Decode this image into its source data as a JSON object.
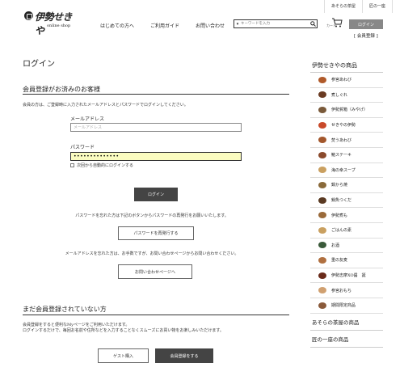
{
  "top_links": [
    "あそらの茶屋",
    "匠の一座"
  ],
  "logo": {
    "main": "伊勢せきや",
    "sub": "online shop"
  },
  "nav": [
    "はじめての方へ",
    "ご利用ガイド",
    "お問い合わせ"
  ],
  "search": {
    "dropdown": "▾",
    "placeholder": "キーワードを入力"
  },
  "cart": {
    "label": "カート"
  },
  "header": {
    "login": "ログイン",
    "register": "[ 会員登録 ]"
  },
  "main": {
    "title": "ログイン",
    "member": {
      "heading": "会員登録がお済みのお客様",
      "desc": "会員の方は、ご登録時に入力されたメールアドレスとパスワードでログインしてください。",
      "email_label": "メールアドレス",
      "email_placeholder": "メールアドレス",
      "password_label": "パスワード",
      "password_value": "••••••••••••••",
      "remember": "次回から自動的にログインする",
      "login_button": "ログイン",
      "forgot_text": "パスワードを忘れた方は下記のボタンからパスワードの再発行をお願いいたします。",
      "reissue_button": "パスワードを再発行する",
      "email_forgot_text": "メールアドレスを忘れた方は、お手数ですが、お問い合わせページからお問い合わせください。",
      "contact_button": "お問い合わせページへ"
    },
    "guest": {
      "heading": "まだ会員登録されていない方",
      "desc1": "会員登録をすると便利なMyページをご利用いただけます。",
      "desc2": "ログインするだけで、毎回お名前や住所などを入力することなくスムーズにお買い物をお楽しみいただけます。",
      "guest_button": "ゲスト購入",
      "register_button": "会員登録をする"
    }
  },
  "sidebar": {
    "heading": "伊勢せきやの商品",
    "items": [
      {
        "label": "参宮あわび",
        "color": "#b05a2a"
      },
      {
        "label": "煮しぐれ",
        "color": "#6a3b22"
      },
      {
        "label": "伊勢賀箱（みやげ）",
        "color": "#7a5a3a"
      },
      {
        "label": "せきやの伊勢",
        "color": "#c94a2a"
      },
      {
        "label": "焚うあわび",
        "color": "#a3572c"
      },
      {
        "label": "鮑ステーキ",
        "color": "#8b4a2c"
      },
      {
        "label": "海の幸スープ",
        "color": "#caa060"
      },
      {
        "label": "鍋から焼",
        "color": "#8a6a3a"
      },
      {
        "label": "鍋魚つくだ",
        "color": "#5a3a22"
      },
      {
        "label": "伊勢煮も",
        "color": "#9a6a3a"
      },
      {
        "label": "ごはんの素",
        "color": "#c9a060"
      },
      {
        "label": "お酒",
        "color": "#3a5a3a"
      },
      {
        "label": "重の友麦",
        "color": "#b07040"
      },
      {
        "label": "伊勢志摩XO醤　誕",
        "color": "#6a2a1a"
      },
      {
        "label": "参宮おもち",
        "color": "#d0a070"
      },
      {
        "label": "期間限定商品",
        "color": "#8a5a3a"
      }
    ],
    "footer": [
      "あそらの茶屋の商品",
      "匠の一座の商品"
    ]
  }
}
